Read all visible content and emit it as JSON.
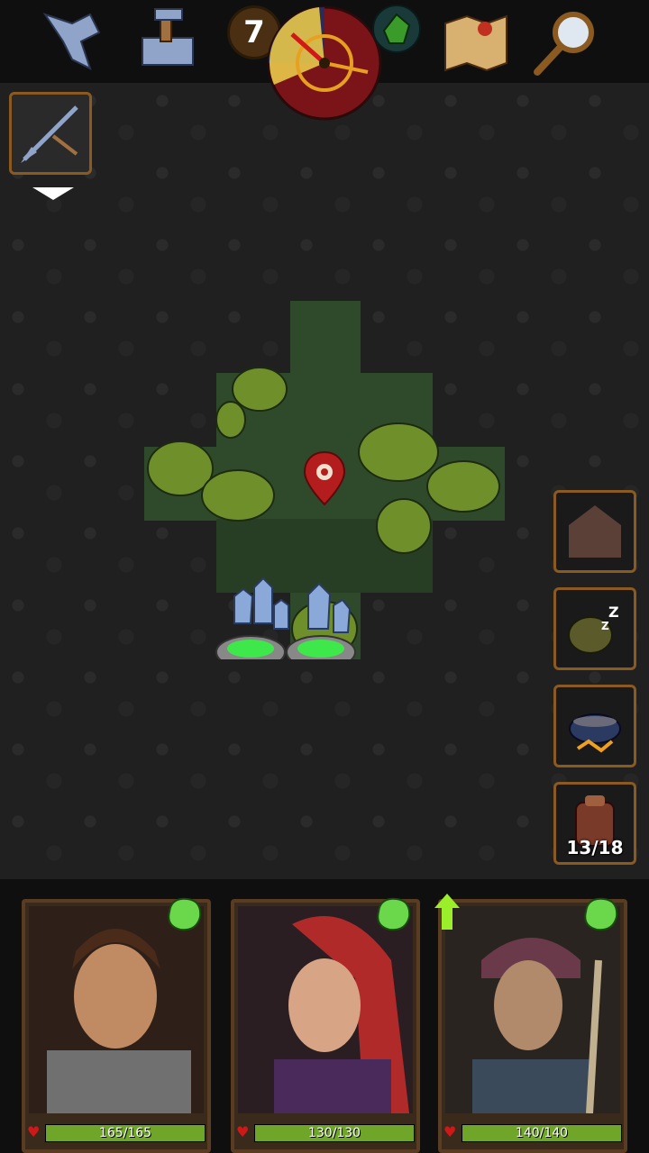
{
  "topbar": {
    "icons": [
      "crossbow-icon",
      "anvil-icon",
      "goblin-icon",
      "treasure-map-icon",
      "magnifier-icon"
    ],
    "day": "7"
  },
  "equipped_weapon": {
    "icon": "crossbow-bolt-icon"
  },
  "side_actions": [
    {
      "icon": "house-icon",
      "label": ""
    },
    {
      "icon": "sleep-icon",
      "label": ""
    },
    {
      "icon": "cooking-pot-icon",
      "label": ""
    },
    {
      "icon": "backpack-icon",
      "label": "13/18"
    }
  ],
  "party": [
    {
      "hp_text": "165/165",
      "hp_fraction": 1.0,
      "level_up": false
    },
    {
      "hp_text": "130/130",
      "hp_fraction": 1.0,
      "level_up": false
    },
    {
      "hp_text": "140/140",
      "hp_fraction": 1.0,
      "level_up": true
    }
  ],
  "colors": {
    "frame": "#8a5a20",
    "hp_green": "#6fa629",
    "heart_red": "#d01818",
    "forest": "#2f4a2a"
  }
}
